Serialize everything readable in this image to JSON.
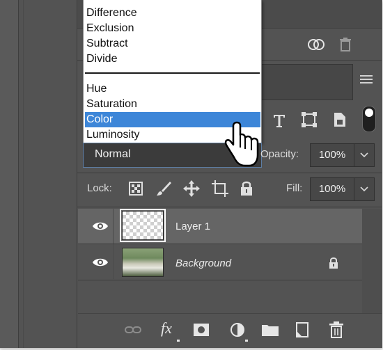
{
  "blend_menu": {
    "items_top": [
      "Difference",
      "Exclusion",
      "Subtract",
      "Divide"
    ],
    "items_bottom": [
      "Hue",
      "Saturation",
      "Color",
      "Luminosity"
    ],
    "selected": "Color"
  },
  "blend_mode": {
    "value": "Normal"
  },
  "opacity": {
    "label": "Opacity:",
    "value": "100%"
  },
  "lock": {
    "label": "Lock:"
  },
  "fill": {
    "label": "Fill:",
    "value": "100%"
  },
  "layers": [
    {
      "name": "Layer 1",
      "visible": true,
      "selected": true
    },
    {
      "name": "Background",
      "visible": true,
      "locked": true
    }
  ],
  "colors": {
    "panel": "#535353",
    "selection": "#3d86d8",
    "row_selected": "#656565"
  },
  "icons": [
    "link-icon",
    "fx-icon",
    "mask-icon",
    "adjustment-icon",
    "folder-icon",
    "new-layer-icon",
    "trash-icon"
  ]
}
